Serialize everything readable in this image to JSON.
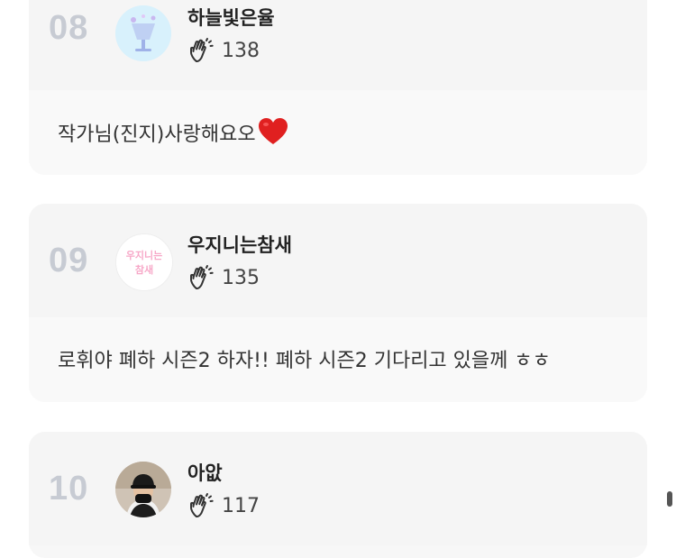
{
  "comments": [
    {
      "rank": "08",
      "nickname": "하늘빛은율",
      "likes": "138",
      "text": "작가님(진지)사랑해요오",
      "avatar_icon": "sparkle-drink-avatar-icon"
    },
    {
      "rank": "09",
      "nickname": "우지니는참새",
      "likes": "135",
      "text": "로휘야 폐하 시즌2 하자!! 폐하 시즌2 기다리고 있을께 ㅎㅎ",
      "avatar_icon": "text-logo-avatar-icon",
      "avatar_text_line1": "우지니는",
      "avatar_text_line2": "참새"
    },
    {
      "rank": "10",
      "nickname": "아앖",
      "likes": "117",
      "avatar_icon": "person-cap-avatar-icon"
    }
  ],
  "colors": {
    "card_bg": "#f7f7f7",
    "rank": "#c7cbd3",
    "heart": "#e02020"
  },
  "icons": {
    "clap": "clap-hands-icon",
    "heart": "heart-emoji-icon"
  }
}
